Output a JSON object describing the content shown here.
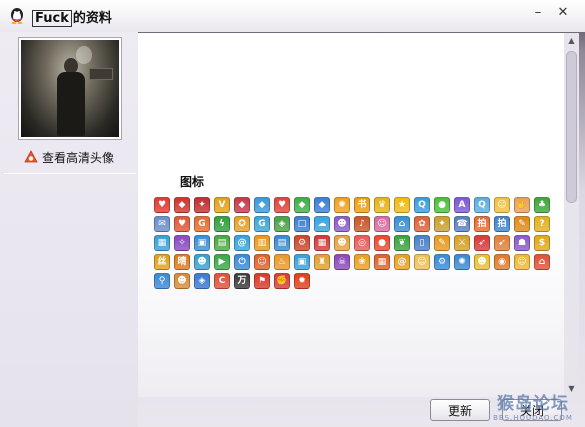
{
  "window": {
    "title_boxed": "Fuck",
    "title_suffix": "的资料",
    "minimize_glyph": "–",
    "close_glyph": "✕"
  },
  "left": {
    "hd_link_label": "查看高清头像"
  },
  "content": {
    "section_title": "图标",
    "icons": [
      {
        "icon": "heart-icon",
        "color": "#e03a2f",
        "glyph": "♥"
      },
      {
        "icon": "diamond-icon",
        "color": "#d0352a",
        "glyph": "◆"
      },
      {
        "icon": "flag-icon",
        "color": "#c12f2f",
        "glyph": "✦"
      },
      {
        "icon": "vip-icon",
        "color": "#e2a21a",
        "glyph": "V"
      },
      {
        "icon": "gem-icon",
        "color": "#c33a4a",
        "glyph": "◆"
      },
      {
        "icon": "crystal-icon",
        "color": "#3a9ad9",
        "glyph": "◆"
      },
      {
        "icon": "red-heart-icon",
        "color": "#e0443a",
        "glyph": "♥"
      },
      {
        "icon": "green-diamond-icon",
        "color": "#3fae49",
        "glyph": "◆"
      },
      {
        "icon": "blue-diamond-icon",
        "color": "#3b7fd6",
        "glyph": "◆"
      },
      {
        "icon": "horn-icon",
        "color": "#f0a020",
        "glyph": "✺"
      },
      {
        "icon": "book-icon",
        "color": "#e9a010",
        "glyph": "书"
      },
      {
        "icon": "crown-icon",
        "color": "#e7b21b",
        "glyph": "♛"
      },
      {
        "icon": "star-icon",
        "color": "#f2b91a",
        "glyph": "★"
      },
      {
        "icon": "search-q-icon",
        "color": "#3b9ed8",
        "glyph": "Q"
      },
      {
        "icon": "chat-icon",
        "color": "#4bbf3a",
        "glyph": "●"
      },
      {
        "icon": "app-icon",
        "color": "#7b5ad6",
        "glyph": "A"
      },
      {
        "icon": "qt-icon",
        "color": "#5aaee0",
        "glyph": "Q"
      },
      {
        "icon": "face-icon",
        "color": "#f0c040",
        "glyph": "☺"
      },
      {
        "icon": "hand-icon",
        "color": "#e8a060",
        "glyph": "✋"
      },
      {
        "icon": "clover-icon",
        "color": "#3da83a",
        "glyph": "♣"
      },
      {
        "icon": "mail-icon",
        "color": "#6a8fc8",
        "glyph": "✉"
      },
      {
        "icon": "heart-box-icon",
        "color": "#e0563a",
        "glyph": "♥"
      },
      {
        "icon": "g-icon",
        "color": "#e86a2a",
        "glyph": "G"
      },
      {
        "icon": "lightning-icon",
        "color": "#30a040",
        "glyph": "ϟ"
      },
      {
        "icon": "badge-icon",
        "color": "#e4a028",
        "glyph": "✪"
      },
      {
        "icon": "ring-icon",
        "color": "#3aa7d6",
        "glyph": "G"
      },
      {
        "icon": "shield-icon",
        "color": "#4aa046",
        "glyph": "◈"
      },
      {
        "icon": "square-icon",
        "color": "#3d7dd0",
        "glyph": "□"
      },
      {
        "icon": "cloud-icon",
        "color": "#39a3e0",
        "glyph": "☁"
      },
      {
        "icon": "pet-icon",
        "color": "#8a5cc8",
        "glyph": "☻"
      },
      {
        "icon": "music-icon",
        "color": "#c8572a",
        "glyph": "♪"
      },
      {
        "icon": "doll-icon",
        "color": "#d86aa0",
        "glyph": "☺"
      },
      {
        "icon": "home-icon",
        "color": "#3a8fd0",
        "glyph": "⌂"
      },
      {
        "icon": "flower-icon",
        "color": "#e0603a",
        "glyph": "✿"
      },
      {
        "icon": "lamp-icon",
        "color": "#c9a030",
        "glyph": "✦"
      },
      {
        "icon": "phone-icon",
        "color": "#5a7fc0",
        "glyph": "☎"
      },
      {
        "icon": "pat-icon",
        "color": "#e86a2a",
        "glyph": "拍"
      },
      {
        "icon": "pat-blue-icon",
        "color": "#3a86d0",
        "glyph": "拍"
      },
      {
        "icon": "tag-icon",
        "color": "#e08a1a",
        "glyph": "✎"
      },
      {
        "icon": "question-icon",
        "color": "#e2b020",
        "glyph": "?"
      },
      {
        "icon": "blocks-icon",
        "color": "#3aa0d8",
        "glyph": "▦"
      },
      {
        "icon": "pin-icon",
        "color": "#8a4ac0",
        "glyph": "✧"
      },
      {
        "icon": "box-icon",
        "color": "#3b8fd6",
        "glyph": "▣"
      },
      {
        "icon": "tiles-icon",
        "color": "#4aa842",
        "glyph": "▤"
      },
      {
        "icon": "swirl-icon",
        "color": "#38a3d8",
        "glyph": "@"
      },
      {
        "icon": "notebook-icon",
        "color": "#e69a1e",
        "glyph": "▥"
      },
      {
        "icon": "scroll-icon",
        "color": "#3a8ad0",
        "glyph": "▤"
      },
      {
        "icon": "robot-icon",
        "color": "#c8482a",
        "glyph": "⚙"
      },
      {
        "icon": "panel-icon",
        "color": "#d23a3a",
        "glyph": "▦"
      },
      {
        "icon": "cat-icon",
        "color": "#e8a040",
        "glyph": "☻"
      },
      {
        "icon": "target-icon",
        "color": "#e85a5a",
        "glyph": "◎"
      },
      {
        "icon": "orb-icon",
        "color": "#e84a30",
        "glyph": "●"
      },
      {
        "icon": "leaf-icon",
        "color": "#3aa240",
        "glyph": "❦"
      },
      {
        "icon": "tablet-icon",
        "color": "#4a7fc8",
        "glyph": "▯"
      },
      {
        "icon": "pencil-icon",
        "color": "#e89a20",
        "glyph": "✎"
      },
      {
        "icon": "sword-icon",
        "color": "#d6a028",
        "glyph": "⚔"
      },
      {
        "icon": "bow-icon",
        "color": "#d83a3a",
        "glyph": "➶"
      },
      {
        "icon": "arrow-icon",
        "color": "#e0803a",
        "glyph": "➹"
      },
      {
        "icon": "wizard-icon",
        "color": "#8a5ac8",
        "glyph": "☗"
      },
      {
        "icon": "coin-icon",
        "color": "#e2a81c",
        "glyph": "$"
      },
      {
        "icon": "silk-icon",
        "color": "#e2a01a",
        "glyph": "丝"
      },
      {
        "icon": "sunny-icon",
        "color": "#e07a1a",
        "glyph": "晴"
      },
      {
        "icon": "figure-icon",
        "color": "#3aa0d0",
        "glyph": "☻"
      },
      {
        "icon": "play-icon",
        "color": "#3aa848",
        "glyph": "▶"
      },
      {
        "icon": "power-icon",
        "color": "#3a8ad6",
        "glyph": "⏻"
      },
      {
        "icon": "cheer-icon",
        "color": "#e0602a",
        "glyph": "☺"
      },
      {
        "icon": "cup-icon",
        "color": "#e89a2a",
        "glyph": "♨"
      },
      {
        "icon": "card-icon",
        "color": "#3aa0d6",
        "glyph": "▣"
      },
      {
        "icon": "castle-icon",
        "color": "#e0a030",
        "glyph": "♜"
      },
      {
        "icon": "monster-icon",
        "color": "#8a4ab8",
        "glyph": "☠"
      },
      {
        "icon": "paw-icon",
        "color": "#e8a020",
        "glyph": "❀"
      },
      {
        "icon": "pixel-icon",
        "color": "#e0602a",
        "glyph": "▦"
      },
      {
        "icon": "spiral-icon",
        "color": "#e8a020",
        "glyph": "@"
      },
      {
        "icon": "girl-icon",
        "color": "#f0c050",
        "glyph": "☺"
      },
      {
        "icon": "gear-icon",
        "color": "#3a8ad6",
        "glyph": "⚙"
      },
      {
        "icon": "dragon-icon",
        "color": "#3a8ad0",
        "glyph": "✺"
      },
      {
        "icon": "pack-icon",
        "color": "#e8c030",
        "glyph": "☻"
      },
      {
        "icon": "game-icon",
        "color": "#e07a2a",
        "glyph": "◉"
      },
      {
        "icon": "smile-icon",
        "color": "#f0b830",
        "glyph": "☺"
      },
      {
        "icon": "house-icon",
        "color": "#e0503a",
        "glyph": "⌂"
      },
      {
        "icon": "search-person-icon",
        "color": "#3a8ad6",
        "glyph": "⚲"
      },
      {
        "icon": "monkey-icon",
        "color": "#d88a3a",
        "glyph": "☻"
      },
      {
        "icon": "guard-icon",
        "color": "#3a7ad0",
        "glyph": "◈"
      },
      {
        "icon": "c-icon",
        "color": "#e0503a",
        "glyph": "C"
      },
      {
        "icon": "wan-icon",
        "color": "#3a3a3a",
        "glyph": "万"
      },
      {
        "icon": "flag-red-icon",
        "color": "#d83a2a",
        "glyph": "⚑"
      },
      {
        "icon": "fight-icon",
        "color": "#d83a3a",
        "glyph": "✊"
      },
      {
        "icon": "fire-icon",
        "color": "#e0401a",
        "glyph": "✹"
      }
    ]
  },
  "buttons": {
    "refresh": "更新",
    "close": "关闭"
  },
  "watermark": {
    "main": "猴岛论坛",
    "sub": "BBS.HOUDAO.COM"
  }
}
